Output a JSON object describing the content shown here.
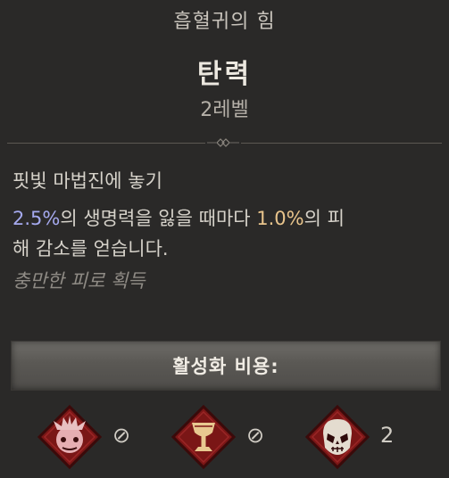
{
  "header": {
    "category": "흡혈귀의 힘",
    "power_name": "탄력",
    "rank": "2레벨"
  },
  "description": {
    "title": "핏빛 마법진에 놓기",
    "line1_value1": "2.5%",
    "line1_text1": "의 생명력을 잃을 때마다 ",
    "line1_value2": "1.0%",
    "line1_text2": "의 피",
    "line2": "해 감소를 얻습니다.",
    "flavor": "충만한 피로 획득"
  },
  "activation": {
    "label": "활성화 비용:",
    "ingredients": [
      {
        "icon": "spiked-mask-icon",
        "count": "⊘"
      },
      {
        "icon": "chalice-icon",
        "count": "⊘"
      },
      {
        "icon": "skull-mask-icon",
        "count": "2"
      }
    ]
  },
  "colors": {
    "background": "#2a2928",
    "value_blue": "#a5a9ee",
    "value_gold": "#e8c48c",
    "flavor_gray": "#8f8b85",
    "ingredient_red": "#7a1616"
  }
}
